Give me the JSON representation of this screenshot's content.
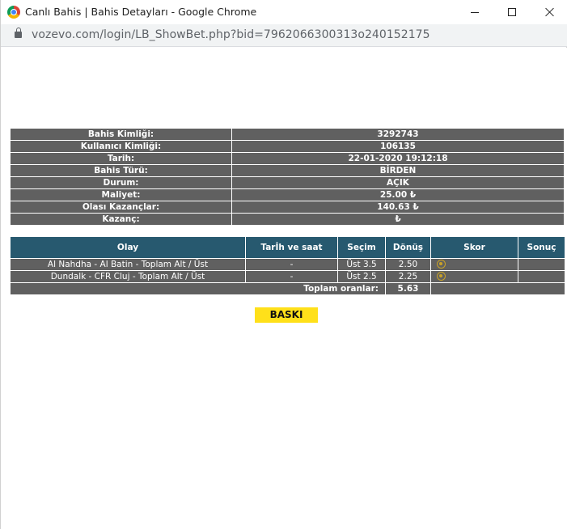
{
  "window": {
    "title": "Canlı Bahis | Bahis Detayları - Google Chrome",
    "url": "vozevo.com/login/LB_ShowBet.php?bid=7962066300313o240152175"
  },
  "details": [
    {
      "label": "Bahis Kimliği:",
      "value": "3292743"
    },
    {
      "label": "Kullanıcı Kimliği:",
      "value": "106135"
    },
    {
      "label": "Tarih:",
      "value": "22-01-2020 19:12:18"
    },
    {
      "label": "Bahis Türü:",
      "value": "BİRDEN"
    },
    {
      "label": "Durum:",
      "value": "AÇIK"
    },
    {
      "label": "Maliyet:",
      "value": "25.00 ₺"
    },
    {
      "label": "Olası Kazançlar:",
      "value": "140.63 ₺"
    },
    {
      "label": "Kazanç:",
      "value": "₺"
    }
  ],
  "events": {
    "headers": [
      "Olay",
      "Tarİh ve saat",
      "Seçim",
      "Dönüş",
      "Skor",
      "Sonuç"
    ],
    "rows": [
      {
        "event": "Al Nahdha - Al Batin - Toplam Alt / Üst",
        "datetime": "-",
        "selection": "Üst 3.5",
        "odds": "2.50",
        "result": ""
      },
      {
        "event": "Dundalk - CFR Cluj - Toplam Alt / Üst",
        "datetime": "-",
        "selection": "Üst 2.5",
        "odds": "2.25",
        "result": ""
      }
    ],
    "total_label": "Toplam oranlar:",
    "total_value": "5.63"
  },
  "print_button": "BASKI",
  "colors": {
    "header_blue": "#27596f",
    "row_gray": "#606060",
    "button_yellow": "#ffe01a"
  }
}
